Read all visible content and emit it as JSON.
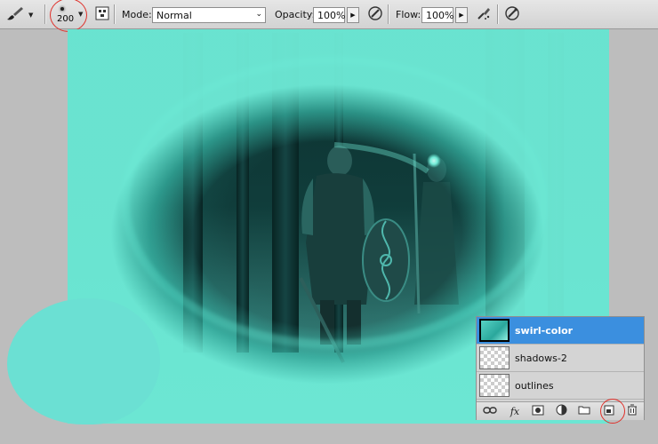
{
  "options_bar": {
    "brush_size": "200",
    "mode_label": "Mode:",
    "mode_value": "Normal",
    "opacity_label": "Opacity:",
    "opacity_value": "100%",
    "flow_label": "Flow:",
    "flow_value": "100%"
  },
  "layers_panel": {
    "layers": [
      {
        "name": "swirl-color",
        "selected": true
      },
      {
        "name": "shadows-2",
        "selected": false
      },
      {
        "name": "outlines",
        "selected": false
      }
    ],
    "footer_icons": [
      "link-layers-icon",
      "fx-icon",
      "layer-mask-icon",
      "adjustment-layer-icon",
      "new-group-icon",
      "new-layer-icon",
      "trash-icon"
    ]
  },
  "colors": {
    "accent_selection": "#3b8fdf",
    "swatch_color": "#6be0d3",
    "highlight_ring": "#e0302a"
  }
}
